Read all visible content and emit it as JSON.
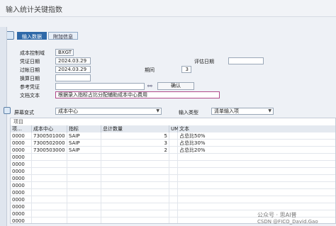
{
  "window": {
    "title": "输入统计关键指数"
  },
  "tabs": [
    {
      "label": "输入数据"
    },
    {
      "label": "附加信息"
    }
  ],
  "form": {
    "controlling_area": {
      "label": "成本控制域",
      "value": "BXGT"
    },
    "document_date": {
      "label": "凭证日期",
      "value": "2024.03.29"
    },
    "value_date": {
      "label": "评估日期",
      "value": ""
    },
    "posting_date": {
      "label": "过帐日期",
      "value": "2024.03.29"
    },
    "period": {
      "label": "期间",
      "value": "3"
    },
    "change_date": {
      "label": "换算日期",
      "value": ""
    },
    "reference": {
      "label": "参考凭证",
      "value": ""
    },
    "doc_text": {
      "label": "文档文本",
      "value": "根据录入指标占比分配辅助成本中心费用"
    },
    "confirm_button": "确认"
  },
  "layout_bar": {
    "screen_variant_label": "屏幕变式",
    "screen_variant_value": "成本中心",
    "input_type_label": "输入类型",
    "input_type_value": "清单输入项"
  },
  "grid": {
    "section_label": "项目",
    "headers": [
      "项…",
      "成本中心",
      "指标",
      "总计数量",
      "UM",
      "文本"
    ],
    "rows": [
      {
        "item": "0000",
        "cost_center": "7300501000",
        "skf": "SAIP",
        "qty": "5",
        "um": "",
        "text": "占总比50%"
      },
      {
        "item": "0000",
        "cost_center": "7300502000",
        "skf": "SAIP",
        "qty": "3",
        "um": "",
        "text": "占总比30%"
      },
      {
        "item": "0000",
        "cost_center": "7300503000",
        "skf": "SAIP",
        "qty": "2",
        "um": "",
        "text": "占总比20%"
      },
      {
        "item": "0000",
        "cost_center": "",
        "skf": "",
        "qty": "",
        "um": "",
        "text": ""
      },
      {
        "item": "0000",
        "cost_center": "",
        "skf": "",
        "qty": "",
        "um": "",
        "text": ""
      },
      {
        "item": "0000",
        "cost_center": "",
        "skf": "",
        "qty": "",
        "um": "",
        "text": ""
      },
      {
        "item": "0000",
        "cost_center": "",
        "skf": "",
        "qty": "",
        "um": "",
        "text": ""
      },
      {
        "item": "0000",
        "cost_center": "",
        "skf": "",
        "qty": "",
        "um": "",
        "text": ""
      },
      {
        "item": "0000",
        "cost_center": "",
        "skf": "",
        "qty": "",
        "um": "",
        "text": ""
      },
      {
        "item": "0000",
        "cost_center": "",
        "skf": "",
        "qty": "",
        "um": "",
        "text": ""
      },
      {
        "item": "0000",
        "cost_center": "",
        "skf": "",
        "qty": "",
        "um": "",
        "text": ""
      },
      {
        "item": "0000",
        "cost_center": "",
        "skf": "",
        "qty": "",
        "um": "",
        "text": ""
      },
      {
        "item": "0000",
        "cost_center": "",
        "skf": "",
        "qty": "",
        "um": "",
        "text": ""
      }
    ]
  },
  "watermark": {
    "line1": "公众号 · 思AI普",
    "line2": "CSDN @FICO_David.Gao"
  }
}
